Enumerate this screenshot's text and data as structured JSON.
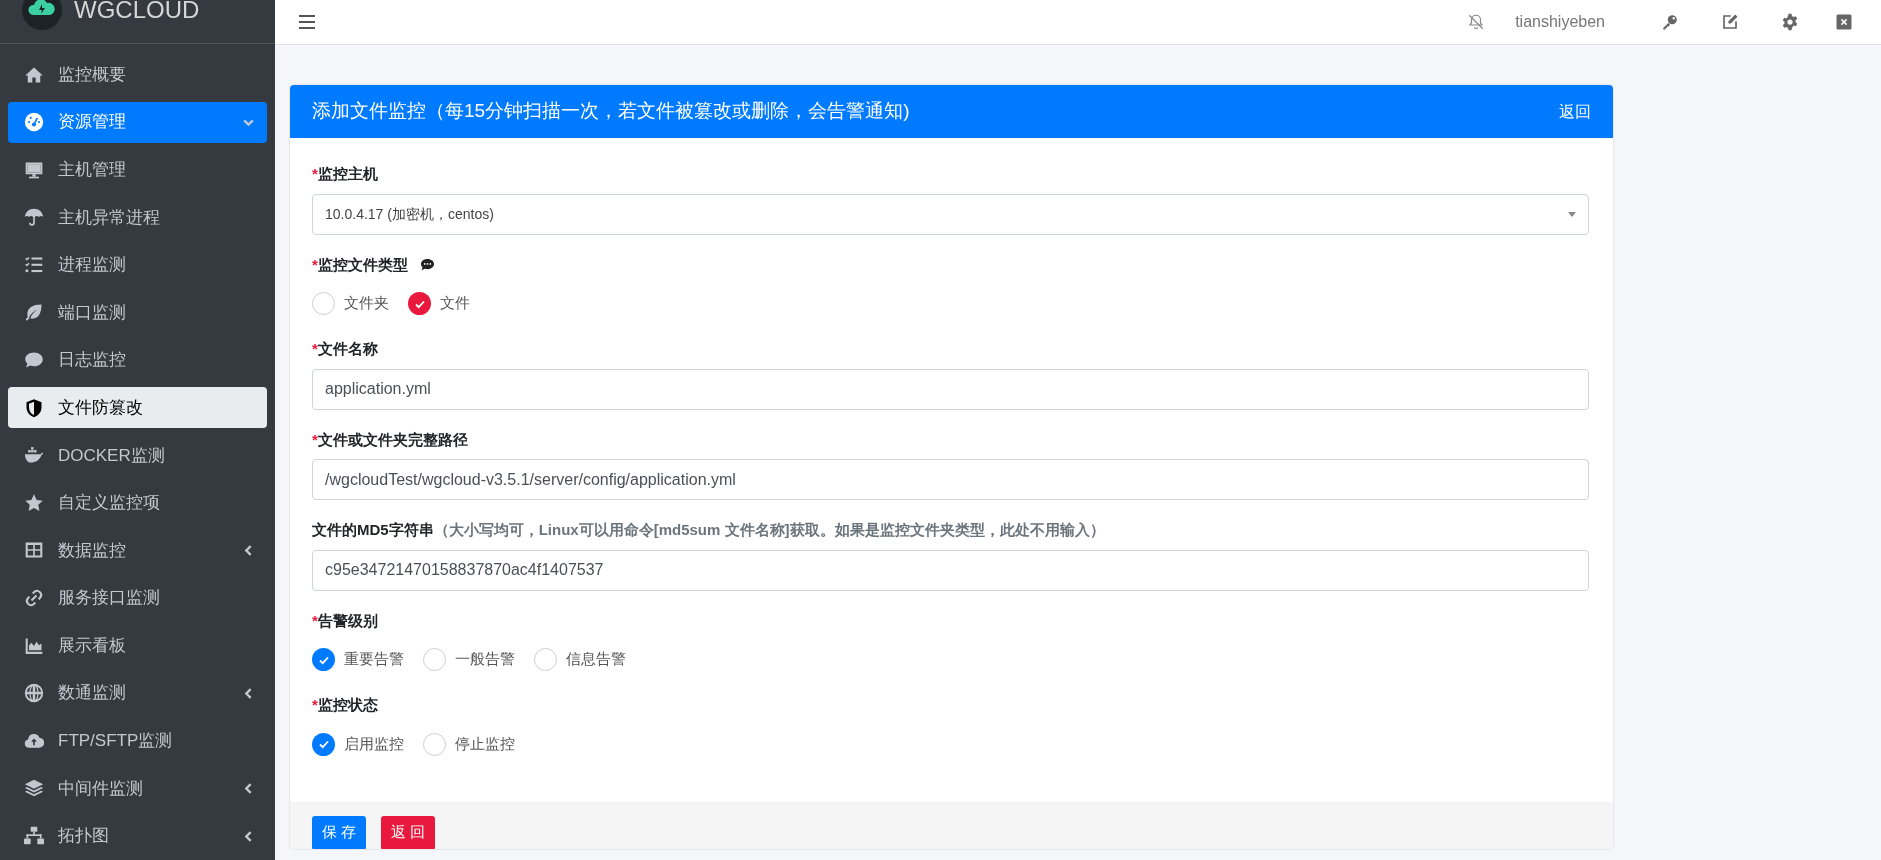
{
  "brand": {
    "name": "WGCLOUD"
  },
  "sidebar": {
    "items": [
      {
        "label": "监控概要",
        "has_submenu": false,
        "expanded": false,
        "selected": false
      },
      {
        "label": "资源管理",
        "has_submenu": true,
        "expanded": true,
        "selected": false
      },
      {
        "label": "主机管理",
        "has_submenu": false,
        "expanded": false,
        "selected": false
      },
      {
        "label": "主机异常进程",
        "has_submenu": false,
        "expanded": false,
        "selected": false
      },
      {
        "label": "进程监测",
        "has_submenu": false,
        "expanded": false,
        "selected": false
      },
      {
        "label": "端口监测",
        "has_submenu": false,
        "expanded": false,
        "selected": false
      },
      {
        "label": "日志监控",
        "has_submenu": false,
        "expanded": false,
        "selected": false
      },
      {
        "label": "文件防篡改",
        "has_submenu": false,
        "expanded": false,
        "selected": true
      },
      {
        "label": "DOCKER监测",
        "has_submenu": false,
        "expanded": false,
        "selected": false
      },
      {
        "label": "自定义监控项",
        "has_submenu": false,
        "expanded": false,
        "selected": false
      },
      {
        "label": "数据监控",
        "has_submenu": true,
        "expanded": false,
        "selected": false
      },
      {
        "label": "服务接口监测",
        "has_submenu": false,
        "expanded": false,
        "selected": false
      },
      {
        "label": "展示看板",
        "has_submenu": false,
        "expanded": false,
        "selected": false
      },
      {
        "label": "数通监测",
        "has_submenu": true,
        "expanded": false,
        "selected": false
      },
      {
        "label": "FTP/SFTP监测",
        "has_submenu": false,
        "expanded": false,
        "selected": false
      },
      {
        "label": "中间件监测",
        "has_submenu": true,
        "expanded": false,
        "selected": false
      },
      {
        "label": "拓扑图",
        "has_submenu": true,
        "expanded": false,
        "selected": false
      }
    ]
  },
  "topbar": {
    "username": "tianshiyeben"
  },
  "card": {
    "title": "添加文件监控（每15分钟扫描一次，若文件被篡改或删除，会告警通知)",
    "back_link": "返回",
    "fields": [
      {
        "kind": "select",
        "asterisk": "*",
        "label": "监控主机",
        "value": "10.0.4.17 (加密机，centos)"
      },
      {
        "kind": "radio",
        "asterisk": "*",
        "label": "监控文件类型",
        "info_icon": true,
        "options": [
          {
            "label": "文件夹",
            "checked": false
          },
          {
            "label": "文件",
            "checked": true
          }
        ]
      },
      {
        "kind": "text",
        "asterisk": "*",
        "label": "文件名称",
        "value": "application.yml"
      },
      {
        "kind": "text",
        "asterisk": "*",
        "label": "文件或文件夹完整路径",
        "value": "/wgcloudTest/wgcloud-v3.5.1/server/config/application.yml"
      },
      {
        "kind": "text",
        "label": "文件的MD5字符串",
        "hint": "（大小写均可，Linux可以用命令[md5sum 文件名称]获取。如果是监控文件夹类型，此处不用输入）",
        "value": "c95e34721470158837870ac4f1407537"
      },
      {
        "kind": "radio",
        "asterisk": "*",
        "label": "告警级别",
        "options": [
          {
            "label": "重要告警",
            "checked": true
          },
          {
            "label": "一般告警",
            "checked": false
          },
          {
            "label": "信息告警",
            "checked": false
          }
        ]
      },
      {
        "kind": "radio",
        "asterisk": "*",
        "label": "监控状态",
        "options": [
          {
            "label": "启用监控",
            "checked": true
          },
          {
            "label": "停止监控",
            "checked": false
          }
        ]
      }
    ],
    "buttons": [
      {
        "label": "保 存",
        "kind": "primary"
      },
      {
        "label": "返 回",
        "kind": "danger"
      }
    ]
  }
}
